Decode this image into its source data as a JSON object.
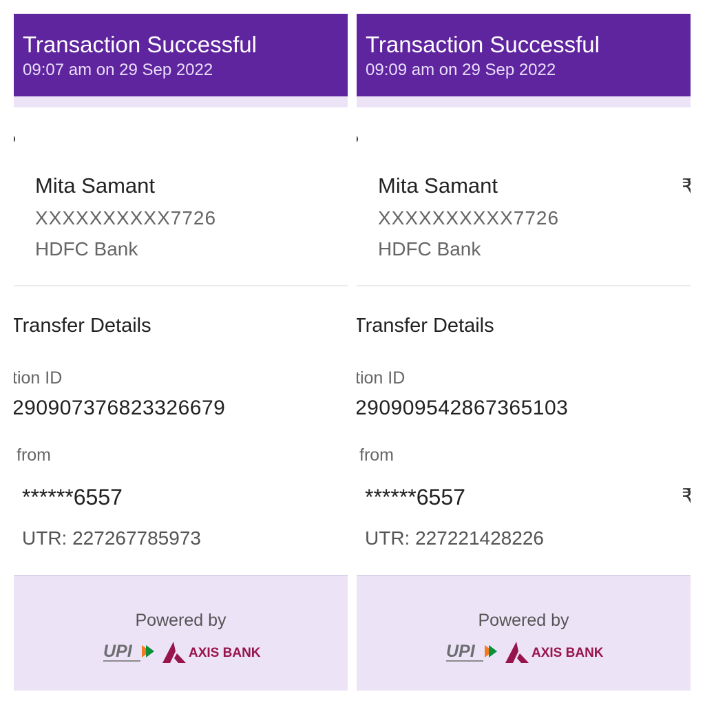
{
  "panels": [
    {
      "header": {
        "title": "Transaction Successful",
        "timestamp": "09:07 am on 29 Sep 2022"
      },
      "payee": {
        "name": "Mita Samant",
        "account": "XXXXXXXXXX7726",
        "bank": "HDFC Bank"
      },
      "transfer": {
        "section_title": "Transfer Details",
        "transaction_id_label": "tion ID",
        "transaction_id": "290907376823326679",
        "debited_from_label": "from",
        "account_masked": "******6557",
        "utr": "UTR: 227267785973"
      },
      "footer": {
        "powered_by": "Powered by",
        "upi_logo_text": "UPI",
        "bank_logo_text": "AXIS BANK"
      }
    },
    {
      "header": {
        "title": "Transaction Successful",
        "timestamp": "09:09 am on 29 Sep 2022"
      },
      "payee": {
        "name": "Mita Samant",
        "account": "XXXXXXXXXX7726",
        "bank": "HDFC Bank",
        "amount_symbol": "₹"
      },
      "transfer": {
        "section_title": "Transfer Details",
        "transaction_id_label": "tion ID",
        "transaction_id": "290909542867365103",
        "debited_from_label": "from",
        "account_masked": "******6557",
        "amount_symbol": "₹",
        "utr": "UTR: 227221428226"
      },
      "footer": {
        "powered_by": "Powered by",
        "upi_logo_text": "UPI",
        "bank_logo_text": "AXIS BANK"
      }
    }
  ],
  "colors": {
    "header_purple": "#5f259f",
    "lavender": "#ede3f6",
    "axis_maroon": "#97144d",
    "upi_orange": "#f47920",
    "upi_green": "#0b8f3a"
  }
}
